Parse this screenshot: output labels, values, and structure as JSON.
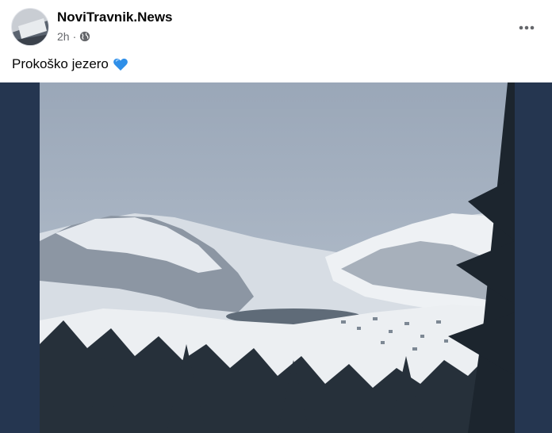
{
  "post": {
    "author": "NoviTravnik.News",
    "time": "2h",
    "separator": "·",
    "audience_icon": "globe-icon",
    "more_icon": "more-horizontal-icon",
    "caption": "Prokoško jezero",
    "caption_emoji": "blue-heart-icon"
  },
  "colors": {
    "media_background": "#253650",
    "accent_heart": "#2f8fe8",
    "text_primary": "#050505",
    "text_secondary": "#65676b"
  }
}
